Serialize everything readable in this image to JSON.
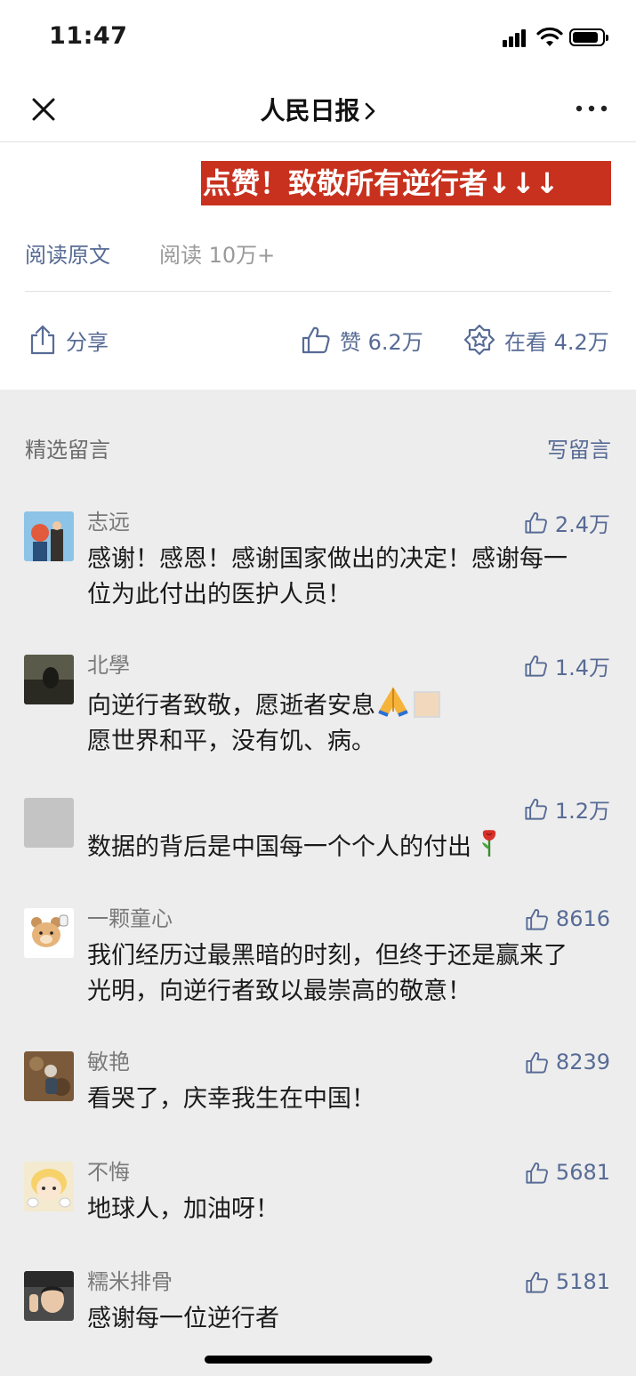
{
  "status": {
    "time": "11:47"
  },
  "nav": {
    "title": "人民日报",
    "close_icon": "close-icon",
    "more_icon": "more-icon"
  },
  "article": {
    "banner": "点赞！致敬所有逆行者↓↓↓",
    "read_original": "阅读原文",
    "read_count": "阅读 10万+"
  },
  "actions": {
    "share": "分享",
    "like": "赞 6.2万",
    "wow": "在看 4.2万"
  },
  "comments_section": {
    "title": "精选留言",
    "write": "写留言"
  },
  "comments": [
    {
      "name": "志远",
      "likes": "2.4万",
      "line1": "感谢！感恩！感谢国家做出的决定！感谢每一",
      "line2": "位为此付出的医护人员！"
    },
    {
      "name": "北學",
      "likes": "1.4万",
      "line1": "向逆行者致敬，愿逝者安息",
      "line2": "愿世界和平，没有饥、病。"
    },
    {
      "name": "",
      "likes": "1.2万",
      "line1": "数据的背后是中国每一个个人的付出"
    },
    {
      "name": "一颗童心",
      "likes": "8616",
      "line1": "我们经历过最黑暗的时刻，但终于还是赢来了",
      "line2": "光明，向逆行者致以最崇高的敬意！"
    },
    {
      "name": "敏艳",
      "likes": "8239",
      "line1": "看哭了，庆幸我生在中国！"
    },
    {
      "name": "不悔",
      "likes": "5681",
      "line1": "地球人，加油呀！"
    },
    {
      "name": "糯米排骨",
      "likes": "5181",
      "line1": "感谢每一位逆行者"
    }
  ]
}
